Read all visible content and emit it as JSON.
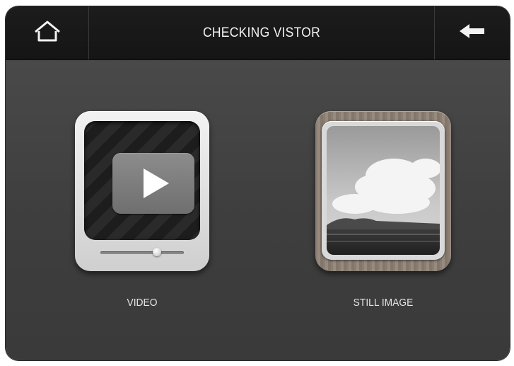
{
  "header": {
    "title": "CHECKING VISTOR",
    "home_icon": "home-icon",
    "back_icon": "back-arrow-icon"
  },
  "options": {
    "video": {
      "label": "VIDEO",
      "icon": "video-player-icon"
    },
    "still_image": {
      "label": "STILL IMAGE",
      "icon": "photo-icon"
    }
  },
  "colors": {
    "topbar": "#161616",
    "background": "#444444",
    "text": "#f2f2f2"
  }
}
